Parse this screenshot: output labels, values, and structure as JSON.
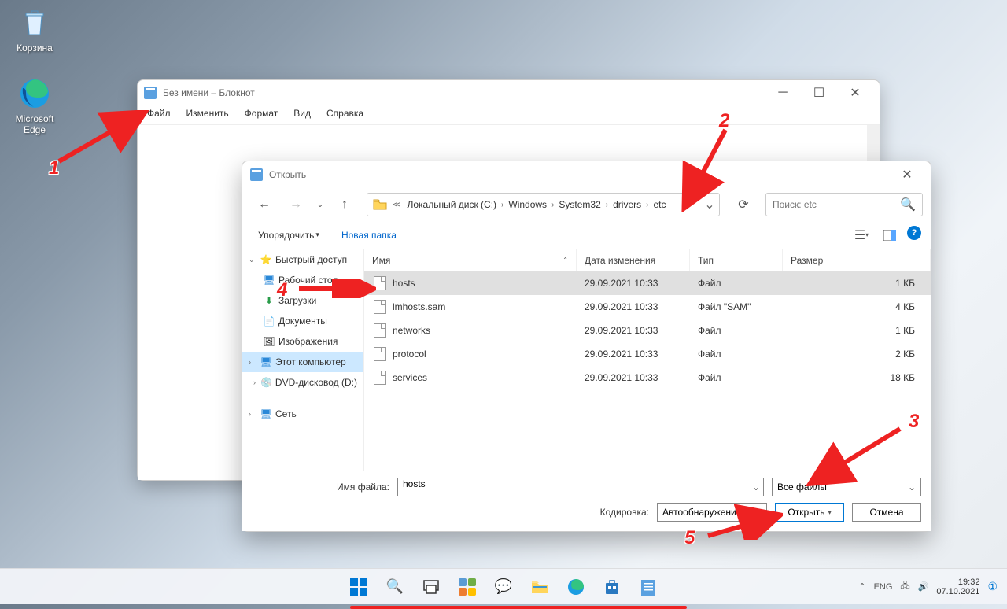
{
  "desktop": {
    "recycle": "Корзина",
    "edge": "Microsoft Edge"
  },
  "notepad": {
    "title": "Без имени – Блокнот",
    "menu": {
      "file": "Файл",
      "edit": "Изменить",
      "format": "Формат",
      "view": "Вид",
      "help": "Справка"
    }
  },
  "dialog": {
    "title": "Открыть",
    "breadcrumb": {
      "disk": "Локальный диск (C:)",
      "p1": "Windows",
      "p2": "System32",
      "p3": "drivers",
      "p4": "etc"
    },
    "search_placeholder": "Поиск: etc",
    "organize": "Упорядочить",
    "new_folder": "Новая папка",
    "columns": {
      "name": "Имя",
      "date": "Дата изменения",
      "type": "Тип",
      "size": "Размер"
    },
    "sidebar": {
      "quick": "Быстрый доступ",
      "desktop": "Рабочий стол",
      "downloads": "Загрузки",
      "documents": "Документы",
      "pictures": "Изображения",
      "thispc": "Этот компьютер",
      "dvd": "DVD-дисковод (D:)",
      "network": "Сеть"
    },
    "files": [
      {
        "name": "hosts",
        "date": "29.09.2021 10:33",
        "type": "Файл",
        "size": "1 КБ",
        "selected": true
      },
      {
        "name": "lmhosts.sam",
        "date": "29.09.2021 10:33",
        "type": "Файл \"SAM\"",
        "size": "4 КБ",
        "selected": false
      },
      {
        "name": "networks",
        "date": "29.09.2021 10:33",
        "type": "Файл",
        "size": "1 КБ",
        "selected": false
      },
      {
        "name": "protocol",
        "date": "29.09.2021 10:33",
        "type": "Файл",
        "size": "2 КБ",
        "selected": false
      },
      {
        "name": "services",
        "date": "29.09.2021 10:33",
        "type": "Файл",
        "size": "18 КБ",
        "selected": false
      }
    ],
    "filename_label": "Имя файла:",
    "filename_value": "hosts",
    "filter": "Все файлы",
    "encoding_label": "Кодировка:",
    "encoding_value": "Автообнаружение",
    "open_btn": "Открыть",
    "cancel_btn": "Отмена"
  },
  "annotations": {
    "n1": "1",
    "n2": "2",
    "n3": "3",
    "n4": "4",
    "n5": "5"
  },
  "taskbar": {
    "lang": "ENG",
    "time": "19:32",
    "date": "07.10.2021"
  }
}
